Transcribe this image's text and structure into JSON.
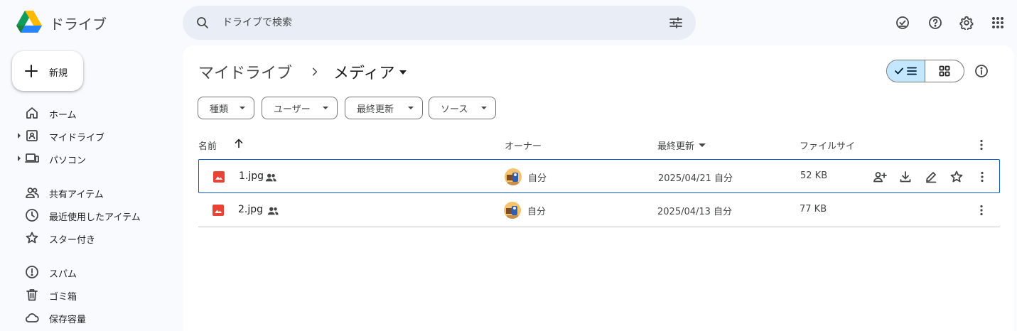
{
  "app": {
    "title": "ドライブ"
  },
  "search": {
    "placeholder": "ドライブで検索"
  },
  "sidebar": {
    "new_label": "新規",
    "items": [
      {
        "label": "ホーム",
        "icon": "home-icon"
      },
      {
        "label": "マイドライブ",
        "icon": "my-drive-icon"
      },
      {
        "label": "パソコン",
        "icon": "computer-icon"
      },
      {
        "label": "共有アイテム",
        "icon": "shared-people-icon"
      },
      {
        "label": "最近使用したアイテム",
        "icon": "clock-icon"
      },
      {
        "label": "スター付き",
        "icon": "star-icon"
      },
      {
        "label": "スパム",
        "icon": "spam-icon"
      },
      {
        "label": "ゴミ箱",
        "icon": "trash-icon"
      },
      {
        "label": "保存容量",
        "icon": "cloud-icon"
      }
    ]
  },
  "breadcrumb": {
    "root": "マイドライブ",
    "current": "メディア"
  },
  "filters": [
    "種類",
    "ユーザー",
    "最終更新",
    "ソース"
  ],
  "columns": {
    "name": "名前",
    "owner": "オーナー",
    "modified": "最終更新",
    "size": "ファイルサイ"
  },
  "files": [
    {
      "name": "1.jpg",
      "owner": "自分",
      "modified": "2025/04/21 自分",
      "size": "52 KB",
      "selected": true
    },
    {
      "name": "2.jpg",
      "owner": "自分",
      "modified": "2025/04/13 自分",
      "size": "77 KB",
      "selected": false
    }
  ],
  "colors": {
    "accent": "#0b57d0",
    "selected_toggle": "#c2e7ff",
    "image_icon": "#ea4335",
    "search_bg": "#e9eef6"
  }
}
